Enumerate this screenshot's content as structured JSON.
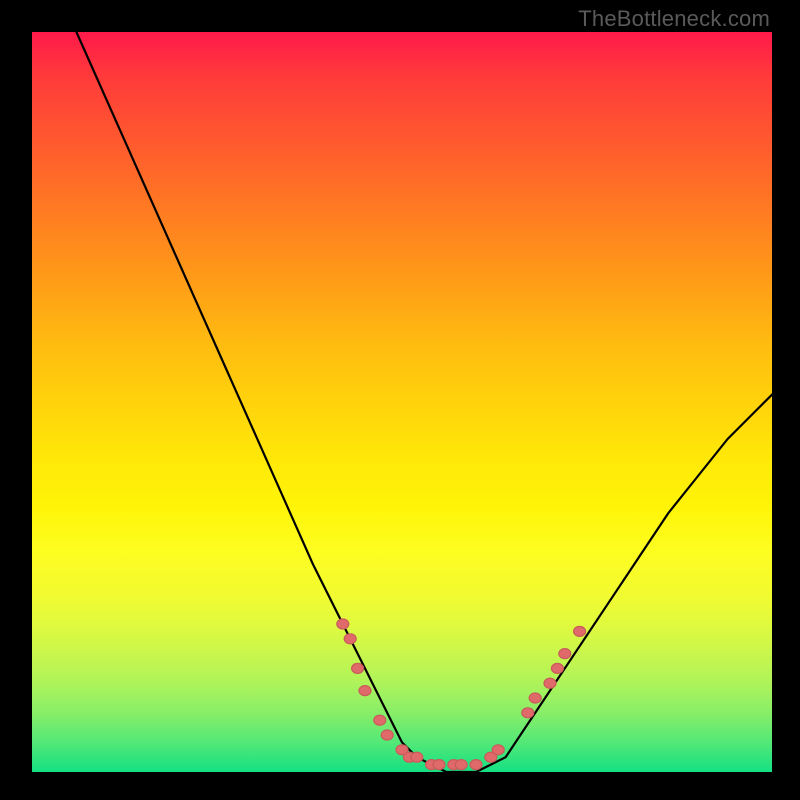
{
  "watermark": "TheBottleneck.com",
  "chart_data": {
    "type": "line",
    "title": "",
    "xlabel": "",
    "ylabel": "",
    "xlim": [
      0,
      100
    ],
    "ylim": [
      0,
      100
    ],
    "grid": false,
    "legend": false,
    "annotations": [],
    "background_gradient": {
      "direction": "vertical",
      "stops": [
        {
          "pos": 0.0,
          "color": "#ff1a4a"
        },
        {
          "pos": 0.5,
          "color": "#ffd80a"
        },
        {
          "pos": 0.8,
          "color": "#e0fa3e"
        },
        {
          "pos": 1.0,
          "color": "#14e083"
        }
      ]
    },
    "series": [
      {
        "name": "bottleneck-curve",
        "x": [
          6,
          10,
          14,
          18,
          22,
          26,
          30,
          34,
          38,
          42,
          46,
          50,
          52,
          54,
          56,
          58,
          60,
          62,
          64,
          66,
          70,
          74,
          78,
          82,
          86,
          90,
          94,
          98,
          100
        ],
        "y": [
          100,
          91,
          82,
          73,
          64,
          55,
          46,
          37,
          28,
          20,
          12,
          4,
          2,
          1,
          0,
          0,
          0,
          1,
          2,
          5,
          11,
          17,
          23,
          29,
          35,
          40,
          45,
          49,
          51
        ]
      }
    ],
    "markers": {
      "name": "highlight-points",
      "color": "#e06a6a",
      "points": [
        {
          "x": 42,
          "y": 20
        },
        {
          "x": 43,
          "y": 18
        },
        {
          "x": 44,
          "y": 14
        },
        {
          "x": 45,
          "y": 11
        },
        {
          "x": 47,
          "y": 7
        },
        {
          "x": 48,
          "y": 5
        },
        {
          "x": 50,
          "y": 3
        },
        {
          "x": 51,
          "y": 2
        },
        {
          "x": 52,
          "y": 2
        },
        {
          "x": 54,
          "y": 1
        },
        {
          "x": 55,
          "y": 1
        },
        {
          "x": 57,
          "y": 1
        },
        {
          "x": 58,
          "y": 1
        },
        {
          "x": 60,
          "y": 1
        },
        {
          "x": 62,
          "y": 2
        },
        {
          "x": 63,
          "y": 3
        },
        {
          "x": 67,
          "y": 8
        },
        {
          "x": 68,
          "y": 10
        },
        {
          "x": 70,
          "y": 12
        },
        {
          "x": 71,
          "y": 14
        },
        {
          "x": 72,
          "y": 16
        },
        {
          "x": 74,
          "y": 19
        }
      ]
    }
  }
}
